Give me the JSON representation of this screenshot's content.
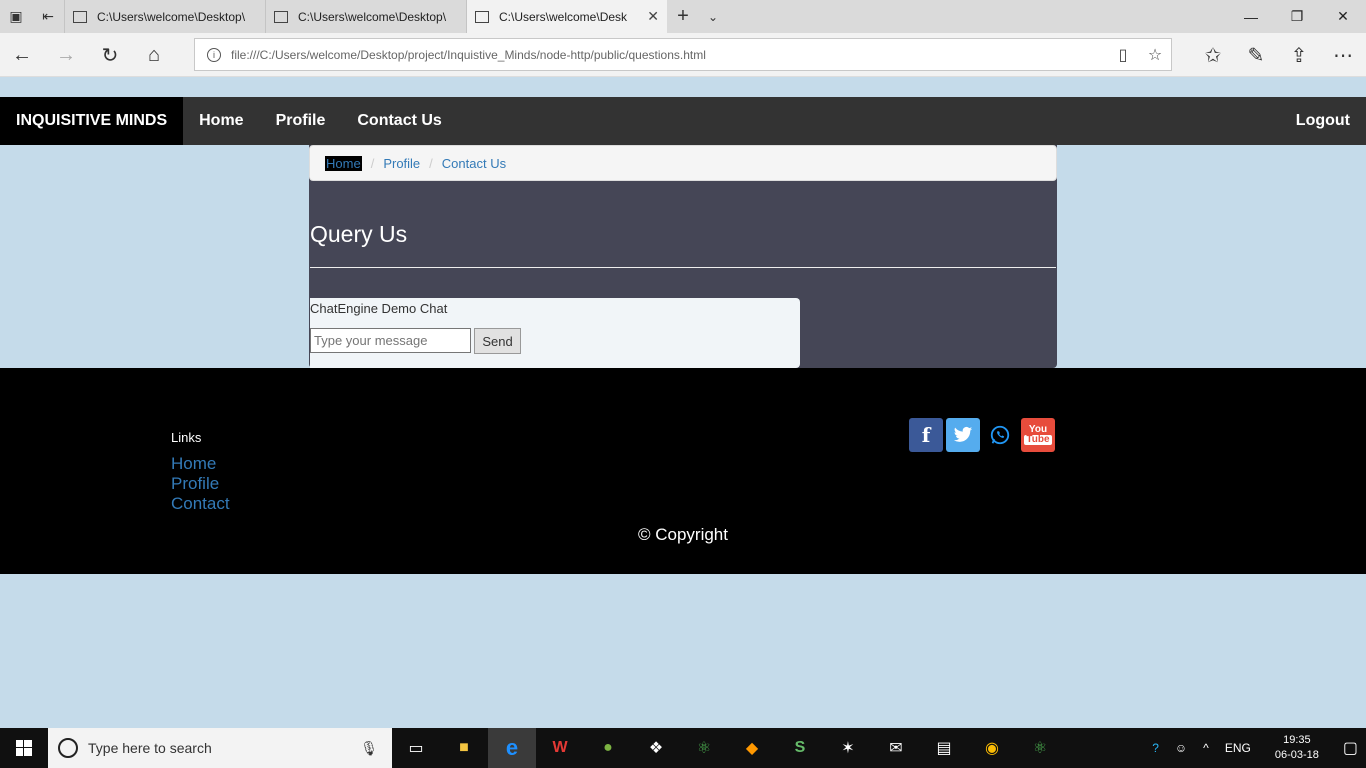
{
  "browser": {
    "tabs": [
      {
        "title": "C:\\Users\\welcome\\Desktop\\",
        "active": false
      },
      {
        "title": "C:\\Users\\welcome\\Desktop\\",
        "active": false
      },
      {
        "title": "C:\\Users\\welcome\\Desk",
        "active": true
      }
    ],
    "url": "file:///C:/Users/welcome/Desktop/project/Inquistive_Minds/node-http/public/questions.html"
  },
  "navbar": {
    "brand": "INQUISITIVE MINDS",
    "links": [
      "Home",
      "Profile",
      "Contact Us"
    ],
    "logout": "Logout"
  },
  "breadcrumb": [
    "Home",
    "Profile",
    "Contact Us"
  ],
  "main": {
    "heading": "Query Us",
    "chat": {
      "title": "ChatEngine Demo Chat",
      "placeholder": "Type your message",
      "send": "Send"
    }
  },
  "footer": {
    "links_title": "Links",
    "links": [
      "Home",
      "Profile",
      "Contact"
    ],
    "copyright": "© Copyright",
    "social": [
      {
        "icon": "facebook-icon",
        "color": "#3b5998"
      },
      {
        "icon": "twitter-icon",
        "color": "#55acee"
      },
      {
        "icon": "whatsapp-icon",
        "color": "#2196f3"
      },
      {
        "icon": "youtube-icon",
        "color": "#e74c3c"
      }
    ]
  },
  "taskbar": {
    "search_placeholder": "Type here to search",
    "language": "ENG",
    "time": "19:35",
    "date": "06-03-18"
  }
}
